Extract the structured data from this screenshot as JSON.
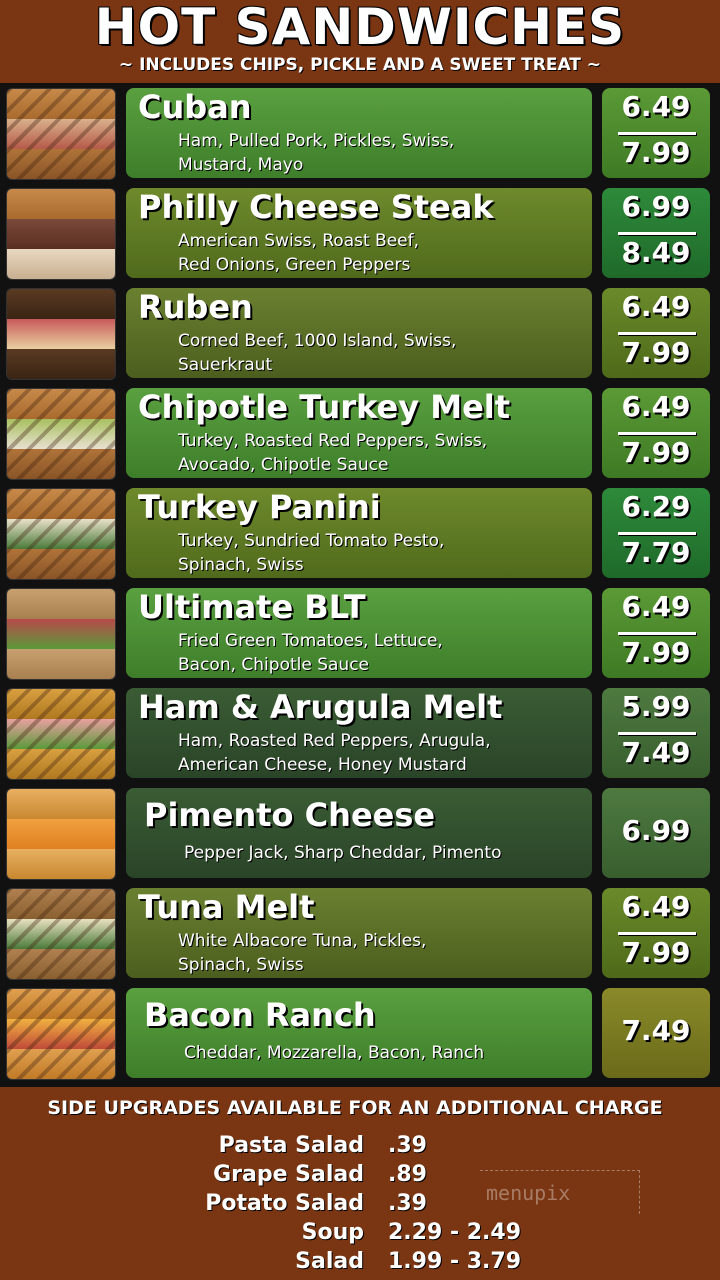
{
  "header": {
    "title": "HOT SANDWICHES",
    "subtitle": "~ INCLUDES CHIPS, PICKLE AND A SWEET TREAT ~"
  },
  "menu": [
    {
      "name": "Cuban",
      "desc1": "Ham, Pulled Pork, Pickles, Swiss,",
      "desc2": "Mustard, Mayo",
      "price_small": "6.49",
      "price_large": "7.99"
    },
    {
      "name": "Philly Cheese Steak",
      "desc1": "American Swiss, Roast Beef,",
      "desc2": "Red Onions, Green Peppers",
      "price_small": "6.99",
      "price_large": "8.49"
    },
    {
      "name": "Ruben",
      "desc1": "Corned Beef, 1000 Island, Swiss,",
      "desc2": "Sauerkraut",
      "price_small": "6.49",
      "price_large": "7.99"
    },
    {
      "name": "Chipotle Turkey Melt",
      "desc1": "Turkey, Roasted Red Peppers, Swiss,",
      "desc2": "Avocado, Chipotle Sauce",
      "price_small": "6.49",
      "price_large": "7.99"
    },
    {
      "name": "Turkey Panini",
      "desc1": "Turkey, Sundried Tomato Pesto,",
      "desc2": "Spinach, Swiss",
      "price_small": "6.29",
      "price_large": "7.79"
    },
    {
      "name": "Ultimate BLT",
      "desc1": "Fried Green Tomatoes, Lettuce,",
      "desc2": "Bacon, Chipotle Sauce",
      "price_small": "6.49",
      "price_large": "7.99"
    },
    {
      "name": "Ham & Arugula Melt",
      "desc1": "Ham, Roasted Red Peppers, Arugula,",
      "desc2": "American Cheese, Honey Mustard",
      "price_small": "5.99",
      "price_large": "7.49"
    },
    {
      "name": "Pimento Cheese",
      "desc1": "Pepper Jack, Sharp Cheddar, Pimento",
      "price": "6.99"
    },
    {
      "name": "Tuna Melt",
      "desc1": "White Albacore Tuna, Pickles,",
      "desc2": "Spinach, Swiss",
      "price_small": "6.49",
      "price_large": "7.99"
    },
    {
      "name": "Bacon Ranch",
      "desc1": "Cheddar, Mozzarella, Bacon, Ranch",
      "price": "7.49"
    }
  ],
  "footer": {
    "title": "SIDE UPGRADES AVAILABLE FOR AN ADDITIONAL CHARGE",
    "sides": [
      {
        "name": "Pasta Salad",
        "price": ".39"
      },
      {
        "name": "Grape Salad",
        "price": ".89"
      },
      {
        "name": "Potato Salad",
        "price": ".39"
      },
      {
        "name": "Soup",
        "price": "2.29 - 2.49"
      },
      {
        "name": "Salad",
        "price": "1.99 - 3.79"
      }
    ]
  },
  "watermark": "menupix",
  "colors": {
    "background": "#7a3513",
    "menu_background": "#111111",
    "text": "#ffffff"
  }
}
